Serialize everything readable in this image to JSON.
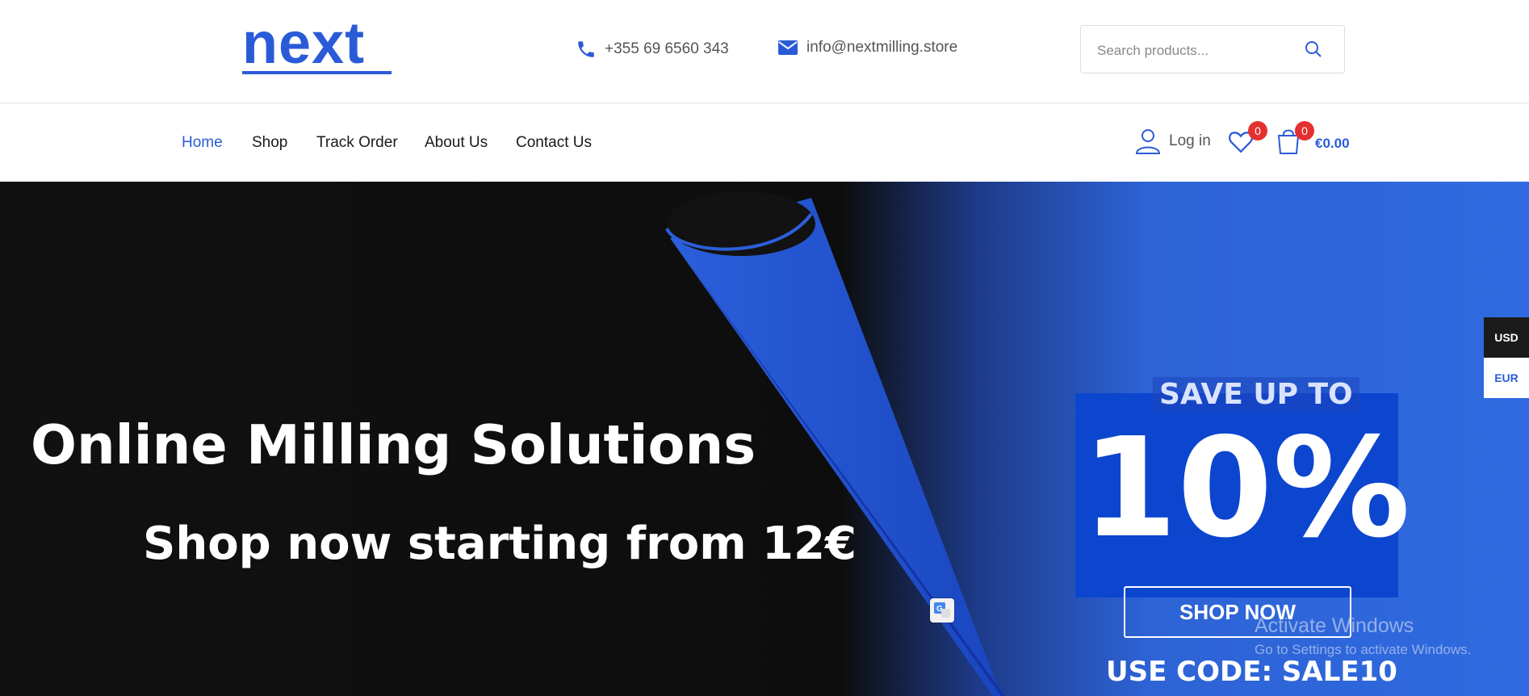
{
  "header": {
    "logo": "next",
    "phone": "+355 69 6560 343",
    "email": "info@nextmilling.store",
    "search_placeholder": "Search products..."
  },
  "nav": {
    "items": [
      {
        "label": "Home",
        "active": true
      },
      {
        "label": "Shop"
      },
      {
        "label": "Track Order"
      },
      {
        "label": "About Us"
      },
      {
        "label": "Contact Us"
      }
    ],
    "login": "Log in",
    "wishlist_count": "0",
    "cart_count": "0",
    "cart_total": "€0.00"
  },
  "hero": {
    "title": "Online Milling Solutions",
    "subtitle": "Shop now starting from 12€",
    "save_label": "SAVE UP TO",
    "discount": "10%",
    "cta": "SHOP NOW",
    "code": "USE CODE: SALE10"
  },
  "currency": {
    "options": [
      "USD",
      "EUR"
    ],
    "selected": "USD"
  },
  "os_overlay": {
    "title": "Activate Windows",
    "subtitle": "Go to Settings to activate Windows."
  },
  "colors": {
    "accent": "#2a5bd7",
    "badge": "#e53030",
    "promo_box": "#0c46cf"
  }
}
